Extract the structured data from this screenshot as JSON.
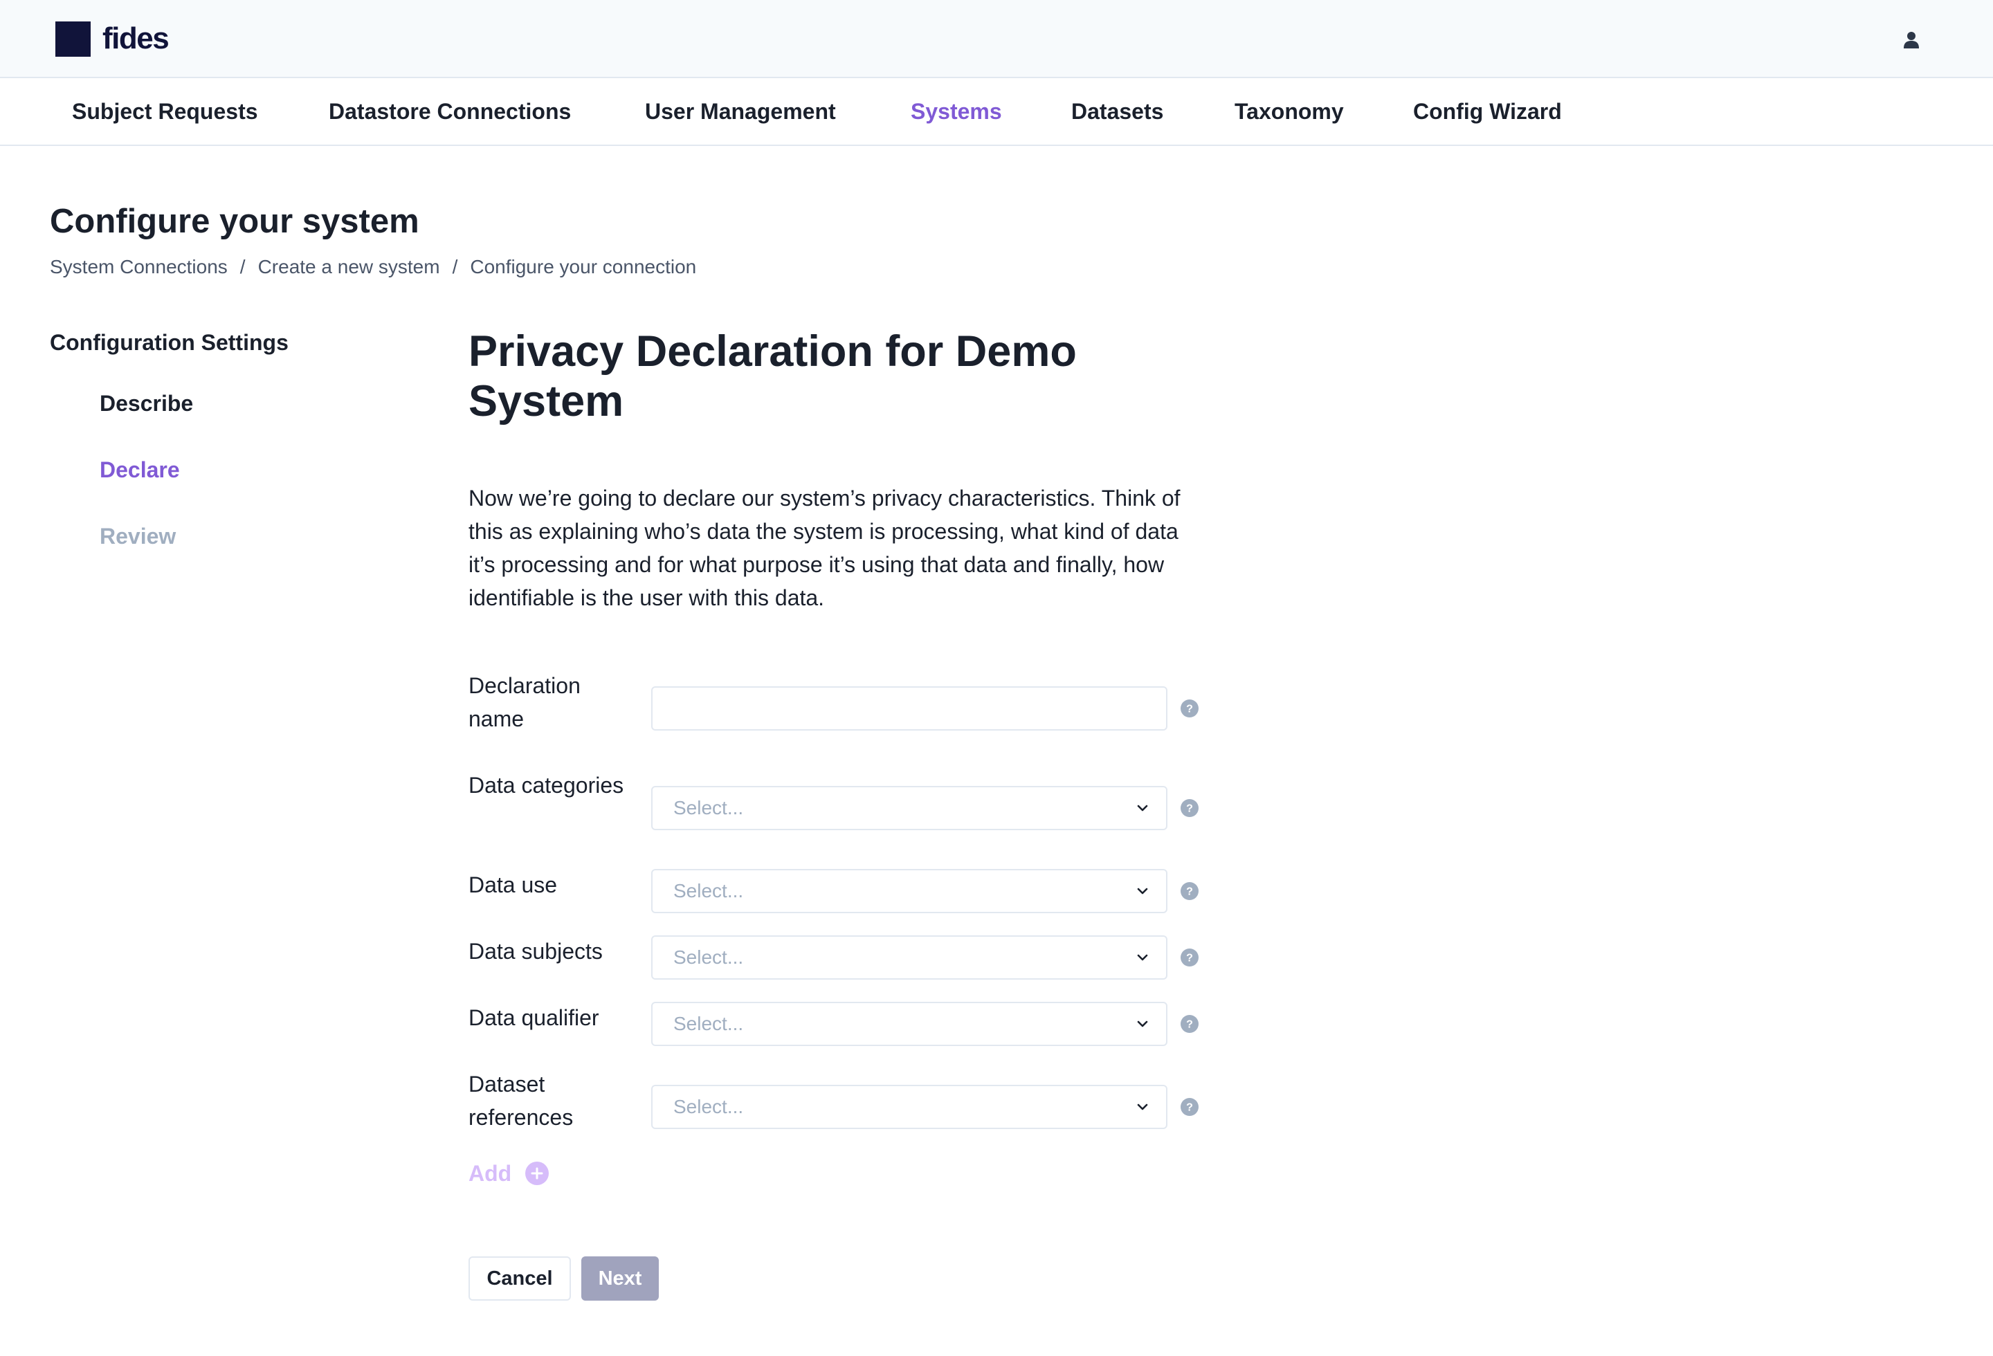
{
  "brand": {
    "name": "fides",
    "logo_icon": "square-logo-icon"
  },
  "header": {
    "user_icon": "user-icon"
  },
  "nav": {
    "items": [
      {
        "label": "Subject Requests",
        "active": false
      },
      {
        "label": "Datastore Connections",
        "active": false
      },
      {
        "label": "User Management",
        "active": false
      },
      {
        "label": "Systems",
        "active": true
      },
      {
        "label": "Datasets",
        "active": false
      },
      {
        "label": "Taxonomy",
        "active": false
      },
      {
        "label": "Config Wizard",
        "active": false
      }
    ]
  },
  "page": {
    "title": "Configure your system",
    "breadcrumb": [
      "System Connections",
      "Create a new system",
      "Configure your connection"
    ],
    "breadcrumb_separator": "/"
  },
  "sidebar": {
    "title": "Configuration Settings",
    "steps": [
      {
        "label": "Describe",
        "state": "complete"
      },
      {
        "label": "Declare",
        "state": "active"
      },
      {
        "label": "Review",
        "state": "upcoming"
      }
    ]
  },
  "form": {
    "title": "Privacy Declaration for Demo System",
    "intro": "Now we’re going to declare our system’s privacy characteristics. Think of this as explaining who’s data the system is processing, what kind of data it’s processing and for what purpose it’s using that data and finally, how identifiable is the user with this data.",
    "fields": {
      "declaration_name": {
        "label": "Declaration name",
        "value": "",
        "placeholder": ""
      },
      "data_categories": {
        "label": "Data categories",
        "placeholder": "Select..."
      },
      "data_use": {
        "label": "Data use",
        "placeholder": "Select..."
      },
      "data_subjects": {
        "label": "Data subjects",
        "placeholder": "Select..."
      },
      "data_qualifier": {
        "label": "Data qualifier",
        "placeholder": "Select..."
      },
      "dataset_references": {
        "label": "Dataset references",
        "placeholder": "Select..."
      }
    },
    "add_label": "Add",
    "cancel_label": "Cancel",
    "next_label": "Next"
  },
  "colors": {
    "accent": "#805ad5",
    "accent_light": "#d6bcfa",
    "text": "#1a202c",
    "muted": "#a0aec0",
    "disabled_button": "#a0a3bd",
    "logo": "#11143a"
  }
}
